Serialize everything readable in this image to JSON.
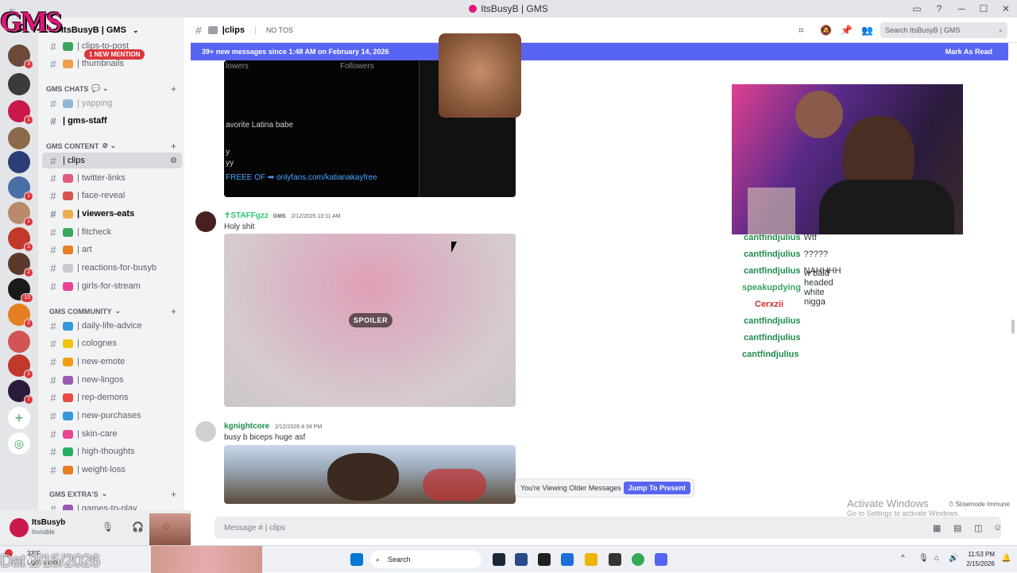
{
  "window": {
    "title": "ItsBusyB | GMS",
    "controls": [
      "─",
      "☐",
      "✕"
    ]
  },
  "server_badges": [
    "3",
    "1",
    "1",
    "1",
    "1",
    "2",
    "15",
    "2",
    "1",
    "7"
  ],
  "sidebar": {
    "guild_name": "ItsBusyB | GMS",
    "logo_text": "GMS",
    "mention_badge": "1 NEW MENTION",
    "channels_top": [
      {
        "name": "clips-to-post",
        "color": "#3ba55d"
      },
      {
        "name": "thumbnails",
        "color": "#f0a04b"
      }
    ],
    "categories": [
      {
        "name": "GMS CHATS",
        "channels": [
          {
            "name": "yapping",
            "color": "#8fb8d8",
            "state": "muted"
          },
          {
            "name": "gms-staff",
            "color": "#2b2d31",
            "state": "unread"
          }
        ]
      },
      {
        "name": "GMS CONTENT",
        "channels": [
          {
            "name": "clips",
            "color": "#9aa0a6",
            "state": "selected"
          },
          {
            "name": "twitter-links",
            "color": "#e05d7a",
            "state": "normal"
          },
          {
            "name": "face-reveal",
            "color": "#d9534f",
            "state": "normal"
          },
          {
            "name": "viewers-eats",
            "color": "#f0ad4e",
            "state": "unread"
          },
          {
            "name": "fitcheck",
            "color": "#3ba55d",
            "state": "normal"
          },
          {
            "name": "art",
            "color": "#e67e22",
            "state": "normal"
          },
          {
            "name": "reactions-for-busyb",
            "color": "#c9cbcf",
            "state": "normal"
          },
          {
            "name": "girls-for-stream",
            "color": "#e84393",
            "state": "normal"
          }
        ]
      },
      {
        "name": "GMS COMMUNITY",
        "channels": [
          {
            "name": "daily-life-advice",
            "color": "#3498db",
            "state": "normal"
          },
          {
            "name": "colognes",
            "color": "#f1c40f",
            "state": "normal"
          },
          {
            "name": "new-emote",
            "color": "#f39c12",
            "state": "normal"
          },
          {
            "name": "new-lingos",
            "color": "#9b59b6",
            "state": "normal"
          },
          {
            "name": "rep-demons",
            "color": "#e74c3c",
            "state": "normal"
          },
          {
            "name": "new-purchases",
            "color": "#3498db",
            "state": "normal"
          },
          {
            "name": "skin-care",
            "color": "#e84393",
            "state": "normal"
          },
          {
            "name": "high-thoughts",
            "color": "#27ae60",
            "state": "normal"
          },
          {
            "name": "weight-loss",
            "color": "#e67e22",
            "state": "normal"
          }
        ]
      },
      {
        "name": "GMS EXTRA'S",
        "channels": [
          {
            "name": "games-to-play",
            "color": "#9b59b6",
            "state": "normal"
          }
        ]
      }
    ]
  },
  "user": {
    "name": "ItsBusyb",
    "status": "Invisible"
  },
  "topbar": {
    "channel": "clips",
    "topic": "NO TOS",
    "search_placeholder": "Search ItsBusyB | GMS"
  },
  "new_messages": {
    "text": "39+ new messages since 1:48 AM on February 14, 2026",
    "action": "Mark As Read"
  },
  "embed": {
    "header": "Followers",
    "header_left": "lowers",
    "caption_1": "avorite Latina babe",
    "caption_2": "y",
    "caption_3": "yy",
    "link": "FREEE OF ➡ onlyfans.com/katianakayfree"
  },
  "messages": [
    {
      "author": "✝STAFFgzz",
      "tag": "GMS",
      "time": "2/12/2026 10:11 AM",
      "text": "Holy shit",
      "spoiler_label": "SPOILER",
      "author_color": "#2dc770"
    },
    {
      "author": "kgnightcore",
      "time": "2/12/2026 4:34 PM",
      "text": "busy b biceps huge asf",
      "author_color": "#1f8b4c"
    }
  ],
  "older_banner": {
    "text": "You're Viewing Older Messages",
    "action": "Jump To Present"
  },
  "composer": {
    "placeholder": "Message # | clips"
  },
  "stream_chat": [
    {
      "user": "cantfindjulius",
      "msg": "Wtf"
    },
    {
      "user": "cantfindjulius",
      "msg": "?????"
    },
    {
      "user": "cantfindjulius",
      "msg": "NAHHHH"
    },
    {
      "user": "speakupdying",
      "msg": "w bald headed white nigga"
    },
    {
      "user": "Cerxzii",
      "msg": ""
    },
    {
      "user": "cantfindjulius",
      "msg": ""
    },
    {
      "user": "cantfindjulius",
      "msg": ""
    },
    {
      "user": "cantfindjulius",
      "msg": ""
    }
  ],
  "activate_windows": {
    "title": "Activate Windows",
    "sub": "Go to Settings to activate Windows.",
    "slowmode": "Slowmode Immune"
  },
  "taskbar": {
    "weather": "33°F",
    "weather_sub": "Light snow",
    "search": "Search",
    "time": "11:53 PM",
    "date": "2/15/2026",
    "overlay_date": "Dat 2/15/2026"
  }
}
